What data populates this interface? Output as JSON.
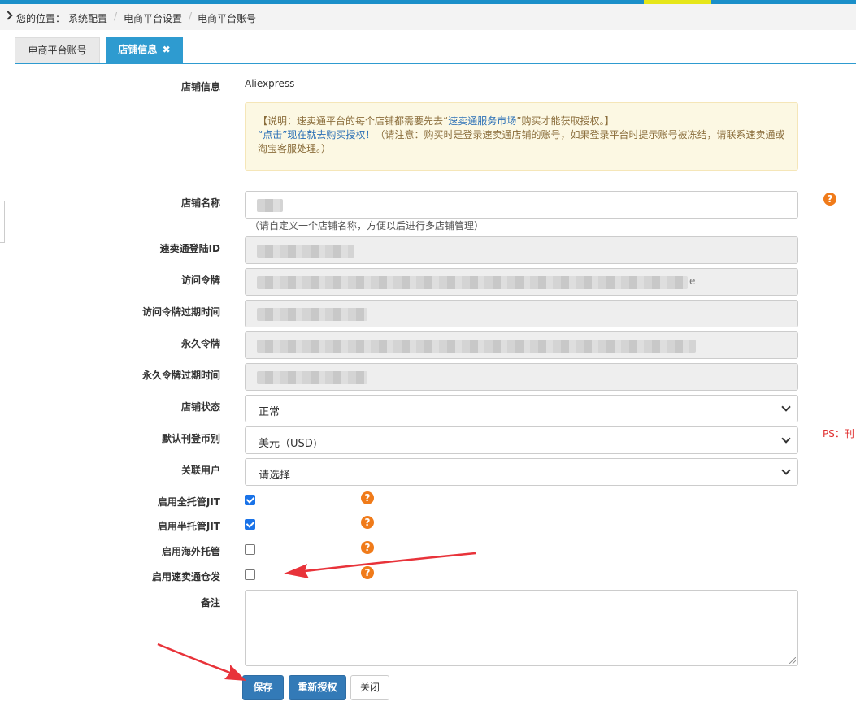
{
  "breadcrumb": {
    "prefix": "您的位置：",
    "items": [
      "系统配置",
      "电商平台设置",
      "电商平台账号"
    ]
  },
  "tabs": {
    "inactive_label": "电商平台账号",
    "active_label": "店铺信息",
    "close_glyph": "✖"
  },
  "form": {
    "shop_info_label": "店铺信息",
    "shop_info_value": "Aliexpress",
    "notice": {
      "line1_pre": "【说明：速卖通平台的每个店铺都需要先去“",
      "line1_link": "速卖通服务市场",
      "line1_post": "”购买才能获取授权。】",
      "line2_link": "“点击”现在就去购买授权！",
      "line2_rest": "（请注意：购买时是登录速卖通店铺的账号，如果登录平台时提示账号被冻结，请联系速卖通或淘宝客服处理。）"
    },
    "shop_name_label": "店铺名称",
    "shop_name_hint": "（请自定义一个店铺名称，方便以后进行多店铺管理）",
    "login_id_label": "速卖通登陆ID",
    "access_token_label": "访问令牌",
    "access_token_tail": "e",
    "access_token_expiry_label": "访问令牌过期时间",
    "refresh_token_label": "永久令牌",
    "refresh_token_expiry_label": "永久令牌过期时间",
    "shop_status_label": "店铺状态",
    "shop_status_value": "正常",
    "currency_label": "默认刊登币别",
    "currency_value": "美元（USD)",
    "currency_ps": "PS：刊",
    "user_label": "关联用户",
    "user_value": "请选择",
    "full_jit_label": "启用全托管JIT",
    "half_jit_label": "启用半托管JIT",
    "overseas_label": "启用海外托管",
    "warehouse_label": "启用速卖通仓发",
    "remark_label": "备注",
    "help_glyph": "?"
  },
  "buttons": {
    "save": "保存",
    "reauth": "重新授权",
    "close": "关闭"
  },
  "colors": {
    "accent": "#2e9bd0",
    "primary_button": "#337ab7",
    "help_icon": "#f07b1a",
    "annotation_arrow": "#e8333a",
    "checkbox_checked": "#1a73e8"
  }
}
